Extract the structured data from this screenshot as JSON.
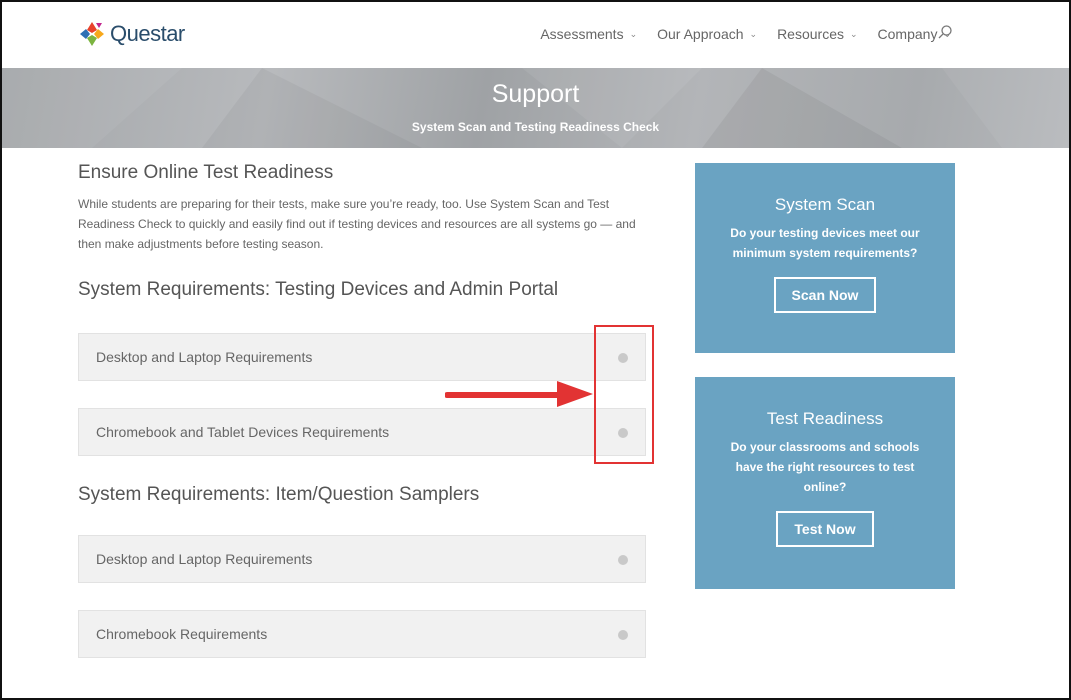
{
  "header": {
    "logo_text": "Questar",
    "nav": [
      {
        "label": "Assessments"
      },
      {
        "label": "Our Approach"
      },
      {
        "label": "Resources"
      },
      {
        "label": "Company"
      }
    ]
  },
  "hero": {
    "title": "Support",
    "subtitle": "System Scan and Testing Readiness Check"
  },
  "main": {
    "intro_heading": "Ensure Online Test Readiness",
    "intro_text": "While students are preparing for their tests, make sure you’re ready, too. Use System Scan and Test Readiness Check to quickly and easily find out if testing devices and resources are all systems go — and then make adjustments before testing season.",
    "section1_heading": "System Requirements: Testing Devices and Admin Portal",
    "section1_items": [
      {
        "label": "Desktop and Laptop Requirements"
      },
      {
        "label": "Chromebook and Tablet Devices Requirements"
      }
    ],
    "section2_heading": "System Requirements: Item/Question Samplers",
    "section2_items": [
      {
        "label": "Desktop and Laptop Requirements"
      },
      {
        "label": "Chromebook Requirements"
      }
    ]
  },
  "sidebar": {
    "system_scan": {
      "title": "System Scan",
      "text": "Do your testing devices meet our minimum system requirements?",
      "button": "Scan Now"
    },
    "test_readiness": {
      "title": "Test Readiness",
      "text": "Do your classrooms and schools have the right resources to test online?",
      "button": "Test Now"
    }
  },
  "colors": {
    "card_bg": "#6aa3c2",
    "annotation_red": "#e23333",
    "logo_text": "#2a4d6b"
  }
}
